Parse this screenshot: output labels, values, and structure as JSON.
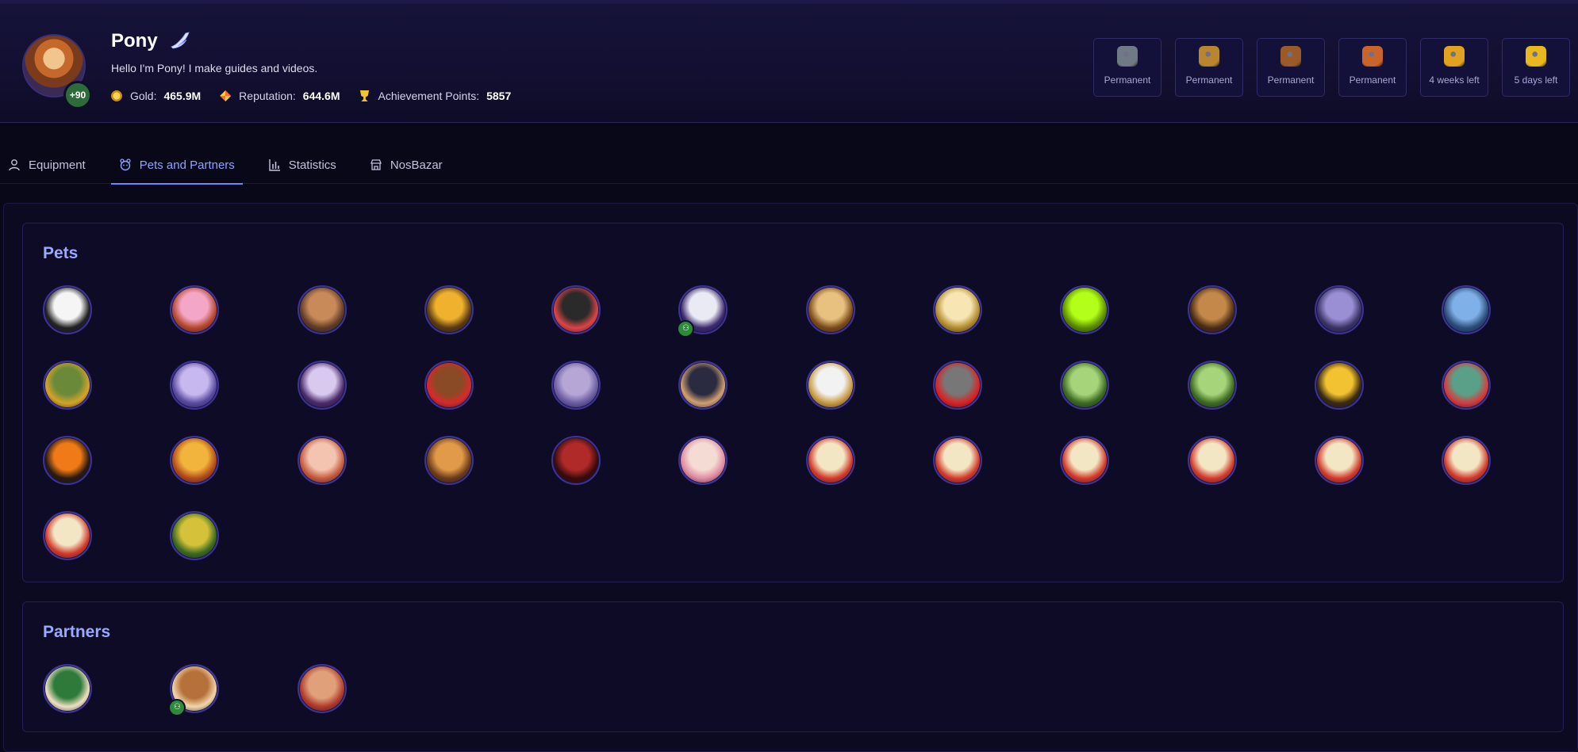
{
  "profile": {
    "name": "Pony",
    "level_badge": "+90",
    "bio": "Hello I'm Pony! I make guides and videos.",
    "stats": [
      {
        "label": "Gold:",
        "value": "465.9M",
        "icon": "gold-icon"
      },
      {
        "label": "Reputation:",
        "value": "644.6M",
        "icon": "reputation-icon"
      },
      {
        "label": "Achievement Points:",
        "value": "5857",
        "icon": "trophy-icon"
      }
    ]
  },
  "buffs": [
    {
      "icon": "buff-scroll-icon",
      "text": "Permanent",
      "color": "#6f7a86"
    },
    {
      "icon": "buff-bag-icon",
      "text": "Permanent",
      "color": "#b8862f"
    },
    {
      "icon": "buff-chest-icon",
      "text": "Permanent",
      "color": "#9a5a2a"
    },
    {
      "icon": "buff-backpack-icon",
      "text": "Permanent",
      "color": "#c9642c"
    },
    {
      "icon": "buff-medal-icon",
      "text": "4 weeks left",
      "color": "#e0a21f"
    },
    {
      "icon": "buff-gold-medal-icon",
      "text": "5 days left",
      "color": "#e8b81e"
    }
  ],
  "tabs": [
    {
      "label": "Equipment",
      "icon": "user-icon",
      "active": false
    },
    {
      "label": "Pets and Partners",
      "icon": "paw-icon",
      "active": true
    },
    {
      "label": "Statistics",
      "icon": "bar-chart-icon",
      "active": false
    },
    {
      "label": "NosBazar",
      "icon": "shop-icon",
      "active": false
    }
  ],
  "pets": {
    "title": "Pets",
    "items": [
      {
        "icon": "panda-pet-icon",
        "colors": [
          "#f5f5f5",
          "#222"
        ],
        "badge": false
      },
      {
        "icon": "pink-girl-pet-icon",
        "colors": [
          "#f4a6c6",
          "#b4472c"
        ],
        "badge": false
      },
      {
        "icon": "cowboy-pet-icon",
        "colors": [
          "#c98a5a",
          "#5e3b26"
        ],
        "badge": false
      },
      {
        "icon": "golden-fish-pet-icon",
        "colors": [
          "#f0b22e",
          "#5a3a10"
        ],
        "badge": false
      },
      {
        "icon": "black-cat-pet-icon",
        "colors": [
          "#2a2a2a",
          "#d44"
        ],
        "badge": false
      },
      {
        "icon": "white-wolf-pet-icon",
        "colors": [
          "#eaeaf4",
          "#3c2a6e"
        ],
        "badge": true
      },
      {
        "icon": "golden-lion-pet-icon",
        "colors": [
          "#e8c080",
          "#7a4b18"
        ],
        "badge": false
      },
      {
        "icon": "unicorn-pet-icon",
        "colors": [
          "#f7e6b4",
          "#b28b2c"
        ],
        "badge": false
      },
      {
        "icon": "green-slime-pet-icon",
        "colors": [
          "#b3ff1a",
          "#5a8a00"
        ],
        "badge": false
      },
      {
        "icon": "eagle-pet-icon",
        "colors": [
          "#c4894a",
          "#4a2c14"
        ],
        "badge": false
      },
      {
        "icon": "armored-griffin-pet-icon",
        "colors": [
          "#9a8fd4",
          "#3a3366"
        ],
        "badge": false
      },
      {
        "icon": "blue-elf-pet-icon",
        "colors": [
          "#7fb0e8",
          "#2b4c7a"
        ],
        "badge": false
      },
      {
        "icon": "green-golem-pet-icon",
        "colors": [
          "#6a8a3a",
          "#d6a326"
        ],
        "badge": false
      },
      {
        "icon": "lilac-girl-pet-icon",
        "colors": [
          "#c8b8f0",
          "#5a4aa0"
        ],
        "badge": false
      },
      {
        "icon": "bone-dragon-pet-icon",
        "colors": [
          "#d9c9ef",
          "#4a2a6a"
        ],
        "badge": false
      },
      {
        "icon": "explorer-pet-icon",
        "colors": [
          "#8a4a26",
          "#d72a2a"
        ],
        "badge": false
      },
      {
        "icon": "helmet-boy-pet-icon",
        "colors": [
          "#b5a6d6",
          "#6a5aa0"
        ],
        "badge": false
      },
      {
        "icon": "ninja-pet-icon",
        "colors": [
          "#2a2a40",
          "#d0a070"
        ],
        "badge": false
      },
      {
        "icon": "captain-pet-icon",
        "colors": [
          "#f2f2f2",
          "#c89a40"
        ],
        "badge": false
      },
      {
        "icon": "hedgehog-pet-icon",
        "colors": [
          "#777",
          "#d22"
        ],
        "badge": false
      },
      {
        "icon": "green-dino-pet-icon",
        "colors": [
          "#a6d47a",
          "#3c6a20"
        ],
        "badge": false
      },
      {
        "icon": "green-dino-2-pet-icon",
        "colors": [
          "#a6d47a",
          "#3c6a20"
        ],
        "badge": false
      },
      {
        "icon": "bee-pet-icon",
        "colors": [
          "#f2c231",
          "#3a2a10"
        ],
        "badge": false
      },
      {
        "icon": "t-rex-pet-icon",
        "colors": [
          "#5aa088",
          "#d63c3c"
        ],
        "badge": false
      },
      {
        "icon": "pumpkin-pet-icon",
        "colors": [
          "#f07a18",
          "#2a1a10"
        ],
        "badge": false
      },
      {
        "icon": "fox-pet-icon",
        "colors": [
          "#f2b43c",
          "#b04a1a"
        ],
        "badge": false
      },
      {
        "icon": "pink-frog-pet-icon",
        "colors": [
          "#f4c4b0",
          "#c45a3c"
        ],
        "badge": false
      },
      {
        "icon": "otter-pet-icon",
        "colors": [
          "#e09a4a",
          "#6a3a18"
        ],
        "badge": false
      },
      {
        "icon": "red-demon-pet-icon",
        "colors": [
          "#b02a2a",
          "#3a0a0a"
        ],
        "badge": false
      },
      {
        "icon": "bunny-pet-icon",
        "colors": [
          "#f4dcd4",
          "#e08aa0"
        ],
        "badge": false
      },
      {
        "icon": "chicken-pet-icon",
        "colors": [
          "#f2e6c4",
          "#d23a2a"
        ],
        "badge": false
      },
      {
        "icon": "chicken-pet-icon",
        "colors": [
          "#f2e6c4",
          "#d23a2a"
        ],
        "badge": false
      },
      {
        "icon": "chicken-pet-icon",
        "colors": [
          "#f2e6c4",
          "#d23a2a"
        ],
        "badge": false
      },
      {
        "icon": "chicken-pet-icon",
        "colors": [
          "#f2e6c4",
          "#d23a2a"
        ],
        "badge": false
      },
      {
        "icon": "chicken-pet-icon",
        "colors": [
          "#f2e6c4",
          "#d23a2a"
        ],
        "badge": false
      },
      {
        "icon": "chicken-pet-icon",
        "colors": [
          "#f2e6c4",
          "#d23a2a"
        ],
        "badge": false
      },
      {
        "icon": "chicken-pet-icon",
        "colors": [
          "#f2e6c4",
          "#d23a2a"
        ],
        "badge": false
      },
      {
        "icon": "bamboo-pet-icon",
        "colors": [
          "#d6c23a",
          "#3a6a20"
        ],
        "badge": false
      }
    ]
  },
  "partners": {
    "title": "Partners",
    "items": [
      {
        "icon": "gift-box-partner-icon",
        "colors": [
          "#2e7a3a",
          "#f0e0c0"
        ],
        "badge": false
      },
      {
        "icon": "bear-partner-icon",
        "colors": [
          "#b6703a",
          "#f2d6a8"
        ],
        "badge": true
      },
      {
        "icon": "angry-cookie-partner-icon",
        "colors": [
          "#e0a07a",
          "#b03a2a"
        ],
        "badge": false
      }
    ]
  },
  "accent_color": "#8ea2ff"
}
